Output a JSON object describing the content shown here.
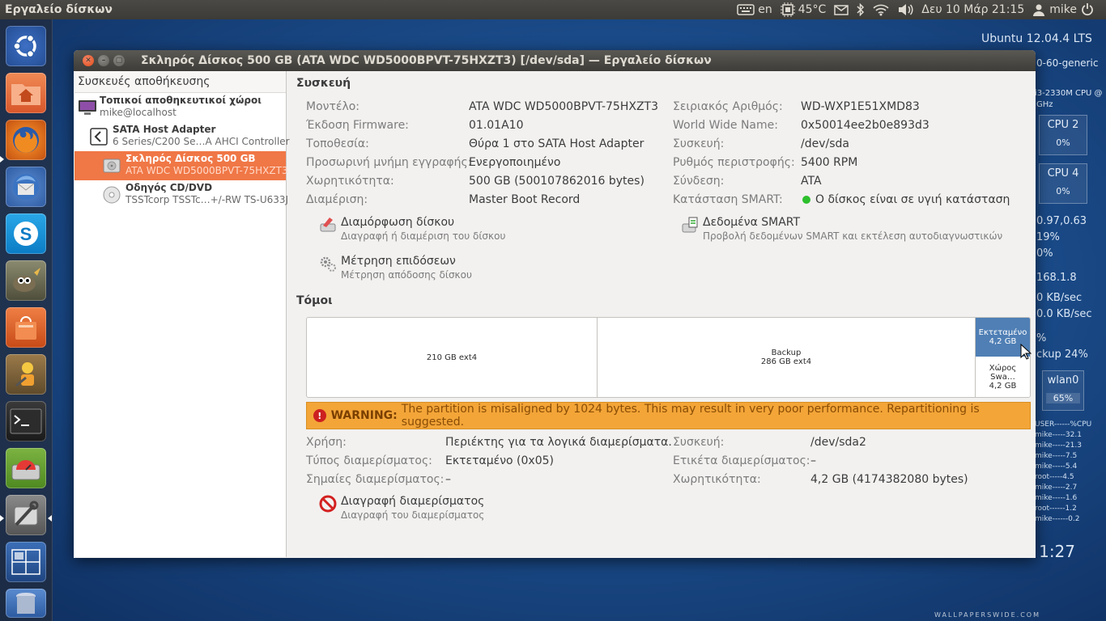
{
  "top_panel": {
    "app_name": "Εργαλείο δίσκων",
    "keyboard_layout": "en",
    "temperature": "45°C",
    "datetime": "Δευ 10 Μάρ 21:15",
    "user": "mike"
  },
  "conky": {
    "os": "Ubuntu 12.04.4 LTS",
    "kernel_fragment": "0-60-generic",
    "cpu_fragment": "i3-2330M CPU @",
    "ghz_fragment": "GHz",
    "cpu2_label": "CPU 2",
    "cpu2_value": "0%",
    "cpu4_label": "CPU 4",
    "cpu4_value": "0%",
    "load_fragment": "0.97,0.63",
    "mem_fragment": "19%",
    "swap_fragment": "0%",
    "ip_fragment": "168.1.8",
    "down_fragment": "0 KB/sec",
    "up_fragment": "0.0 KB/sec",
    "pct_fragment": "%",
    "backup_fragment": "ckup 24%",
    "wlan_label": "wlan0",
    "wlan_value": "65%",
    "proc_header": "USER------%CPU",
    "procs": [
      "mike-----32.1",
      "mike-----21.3",
      "mike-----7.5",
      "mike-----5.4",
      "root-----4.5",
      "mike-----2.7",
      "mike-----1.6",
      "root------1.2",
      "mike------0.2"
    ],
    "time_fragment": ": 1:27",
    "watermark": "WALLPAPERSWIDE.COM"
  },
  "window": {
    "title": "Σκληρός Δίσκος 500 GB (ATA WDC WD5000BPVT-75HXZT3) [/dev/sda] — Εργαλείο δίσκων"
  },
  "sidebar": {
    "header": "Συσκευές αποθήκευσης",
    "items": [
      {
        "title": "Τοπικοί αποθηκευτικοί χώροι",
        "subtitle": "mike@localhost"
      },
      {
        "title": "SATA Host Adapter",
        "subtitle": "6 Series/C200 Se…A AHCI Controller"
      },
      {
        "title": "Σκληρός Δίσκος 500 GB",
        "subtitle": "ATA WDC WD5000BPVT-75HXZT3"
      },
      {
        "title": "Οδηγός CD/DVD",
        "subtitle": "TSSTcorp TSSTc…+/-RW TS-U633J"
      }
    ]
  },
  "device": {
    "section_title": "Συσκευή",
    "left": [
      {
        "label": "Μοντέλο:",
        "value": "ATA WDC WD5000BPVT-75HXZT3"
      },
      {
        "label": "Έκδοση Firmware:",
        "value": "01.01A10"
      },
      {
        "label": "Τοποθεσία:",
        "value": "Θύρα 1 στο SATA Host Adapter"
      },
      {
        "label": "Προσωρινή μνήμη εγγραφής:",
        "value": "Ενεργοποιημένο"
      },
      {
        "label": "Χωρητικότητα:",
        "value": "500 GB (500107862016 bytes)"
      },
      {
        "label": "Διαμέριση:",
        "value": "Master Boot Record"
      }
    ],
    "right": [
      {
        "label": "Σειριακός Αριθμός:",
        "value": "WD-WXP1E51XMD83"
      },
      {
        "label": "World Wide Name:",
        "value": "0x50014ee2b0e893d3"
      },
      {
        "label": "Συσκευή:",
        "value": "/dev/sda"
      },
      {
        "label": "Ρυθμός περιστροφής:",
        "value": "5400 RPM"
      },
      {
        "label": "Σύνδεση:",
        "value": "ATA"
      },
      {
        "label": "Κατάσταση SMART:",
        "value": "Ο δίσκος είναι σε υγιή κατάσταση"
      }
    ],
    "actions": [
      {
        "title": "Διαμόρφωση δίσκου",
        "subtitle": "Διαγραφή ή διαμέριση του δίσκου"
      },
      {
        "title": "Δεδομένα SMART",
        "subtitle": "Προβολή δεδομένων SMART και εκτέλεση αυτοδιαγνωστικών"
      },
      {
        "title": "Μέτρηση επιδόσεων",
        "subtitle": "Μέτρηση απόδοσης δίσκου"
      }
    ]
  },
  "volumes": {
    "section_title": "Τόμοι",
    "items": [
      {
        "line1": "210 GB ext4",
        "line2": ""
      },
      {
        "line1": "Backup",
        "line2": "286 GB ext4"
      },
      {
        "line1": "Εκτεταμένο",
        "line2": "4,2 GB"
      },
      {
        "line1": "Χώρος Swa…",
        "line2": "4,2 GB"
      }
    ],
    "warning_label": "WARNING:",
    "warning_text": "The partition is misaligned by 1024 bytes. This may result in very poor performance. Repartitioning is suggested."
  },
  "partition": {
    "left": [
      {
        "label": "Χρήση:",
        "value": "Περιέκτης για τα λογικά διαμερίσματα."
      },
      {
        "label": "Τύπος διαμερίσματος:",
        "value": "Εκτεταμένο (0x05)"
      },
      {
        "label": "Σημαίες διαμερίσματος:",
        "value": "–"
      }
    ],
    "right": [
      {
        "label": "Συσκευή:",
        "value": "/dev/sda2"
      },
      {
        "label": "Ετικέτα διαμερίσματος:",
        "value": "–"
      },
      {
        "label": "Χωρητικότητα:",
        "value": "4,2 GB (4174382080 bytes)"
      }
    ],
    "delete_action": {
      "title": "Διαγραφή διαμερίσματος",
      "subtitle": "Διαγραφή του διαμερίσματος"
    }
  }
}
